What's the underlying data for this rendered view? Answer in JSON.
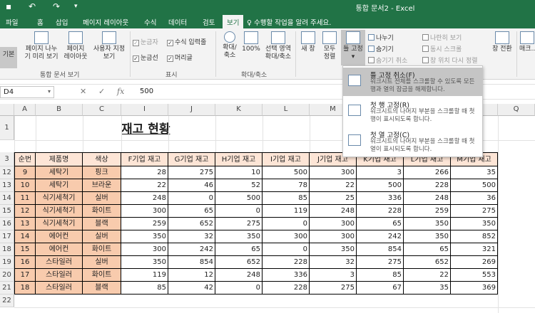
{
  "titlebar": {
    "save_icon": "save-icon",
    "undo_icon": "undo-icon",
    "redo_icon": "redo-icon",
    "title": "통합 문서2 - Excel"
  },
  "tabs": [
    "파일",
    "홈",
    "삽입",
    "페이지 레이아웃",
    "수식",
    "데이터",
    "검토",
    "보기"
  ],
  "tell_me": "수행할 작업을 알려 주세요.",
  "ribbon": {
    "normal": "기본",
    "page_break": "페이지 나누\n기 미리 보기",
    "page_layout": "페이지\n레이아웃",
    "custom_view": "사용자 지정\n보기",
    "group_views": "통합 문서 보기",
    "ruler": "눈금자",
    "formula_bar": "수식 입력줄",
    "gridlines": "눈금선",
    "headings": "머리글",
    "group_show": "표시",
    "zoom": "확대/\n축소",
    "zoom100": "100%",
    "zoom_sel": "선택 영역\n확대/축소",
    "group_zoom": "확대/축소",
    "new_window": "새 창",
    "arrange_all": "모두\n정렬",
    "freeze": "틀 고정",
    "split": "나누기",
    "hide": "숨기기",
    "unhide": "숨기기 취소",
    "side_by_side": "나란히 보기",
    "sync_scroll": "동시 스크롤",
    "reset_pos": "창 위치 다시 정렬",
    "switch": "창 전환",
    "macro": "매크..."
  },
  "formula": {
    "namebox": "D4",
    "value": "500"
  },
  "columns": [
    "A",
    "B",
    "C",
    "I",
    "J",
    "K",
    "L",
    "M",
    "Q"
  ],
  "sheet": {
    "title": "재고 현황",
    "headers": [
      "순번",
      "제품명",
      "색상",
      "F기업 재고",
      "G기업 재고",
      "H기업 재고",
      "I기업 재고",
      "J기업 재고",
      "K기업 재고",
      "L기업 재고",
      "M기업 재고"
    ],
    "rows": [
      {
        "r": "12",
        "n": "9",
        "name": "세탁기",
        "color": "핑크",
        "v": [
          "28",
          "275",
          "10",
          "500",
          "300",
          "3",
          "266",
          "35"
        ]
      },
      {
        "r": "13",
        "n": "10",
        "name": "세탁기",
        "color": "브라운",
        "v": [
          "22",
          "46",
          "52",
          "78",
          "22",
          "500",
          "228",
          "500"
        ]
      },
      {
        "r": "14",
        "n": "11",
        "name": "식기세척기",
        "color": "실버",
        "v": [
          "248",
          "0",
          "500",
          "85",
          "25",
          "336",
          "248",
          "36"
        ]
      },
      {
        "r": "15",
        "n": "12",
        "name": "식기세척기",
        "color": "화이트",
        "v": [
          "300",
          "65",
          "0",
          "119",
          "248",
          "228",
          "259",
          "275"
        ]
      },
      {
        "r": "16",
        "n": "13",
        "name": "식기세척기",
        "color": "블랙",
        "v": [
          "259",
          "652",
          "275",
          "0",
          "300",
          "65",
          "350",
          "350"
        ]
      },
      {
        "r": "17",
        "n": "14",
        "name": "에어컨",
        "color": "실버",
        "v": [
          "350",
          "32",
          "350",
          "300",
          "300",
          "242",
          "350",
          "852"
        ]
      },
      {
        "r": "18",
        "n": "15",
        "name": "에어컨",
        "color": "화이트",
        "v": [
          "300",
          "242",
          "65",
          "0",
          "350",
          "854",
          "65",
          "321"
        ]
      },
      {
        "r": "19",
        "n": "16",
        "name": "스타일러",
        "color": "실버",
        "v": [
          "350",
          "854",
          "652",
          "228",
          "32",
          "275",
          "652",
          "269"
        ]
      },
      {
        "r": "20",
        "n": "17",
        "name": "스타일러",
        "color": "화이트",
        "v": [
          "119",
          "12",
          "248",
          "336",
          "3",
          "85",
          "22",
          "553"
        ]
      },
      {
        "r": "21",
        "n": "18",
        "name": "스타일러",
        "color": "블랙",
        "v": [
          "85",
          "42",
          "0",
          "228",
          "275",
          "67",
          "35",
          "369"
        ]
      }
    ],
    "extra_rows": [
      "1",
      "2",
      "3",
      "22"
    ]
  },
  "dropdown": [
    {
      "title": "틀 고정 취소(F)",
      "desc": "워크시트 전체를 스크롤할 수 있도록 모든 행과 열의 잠금을 해제합니다."
    },
    {
      "title": "첫 행 고정(R)",
      "desc": "워크시트의 나머지 부분을 스크롤할 때 첫 행이 표시되도록 합니다."
    },
    {
      "title": "첫 열 고정(C)",
      "desc": "워크시트의 나머지 부분을 스크롤할 때 첫 열이 표시되도록 합니다."
    }
  ],
  "colors": {
    "accent": "#217346",
    "header_fill": "#fde5d6",
    "data_fill": "#f8cbad"
  }
}
